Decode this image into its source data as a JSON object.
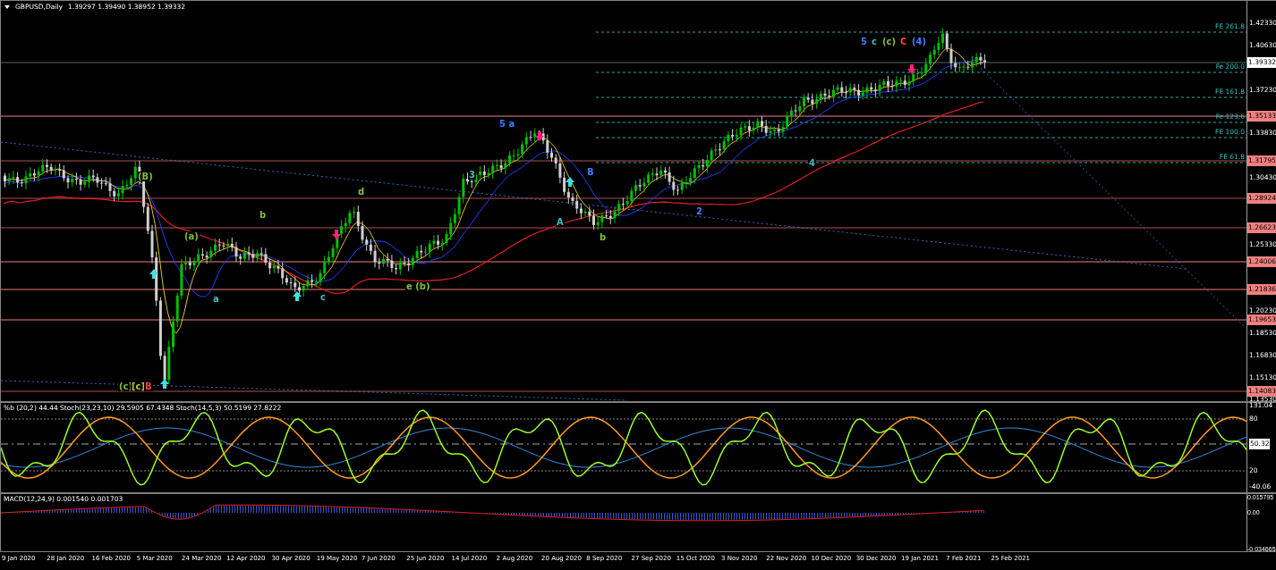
{
  "header": {
    "symbol": "GBPUSD,Daily",
    "quotes": "1.39297 1.39490 1.38952 1.39332"
  },
  "price_axis": [
    "1.42330",
    "1.40630",
    "1.37230",
    "1.33830",
    "1.30430",
    "1.25330",
    "1.20230",
    "1.18530",
    "1.16830",
    "1.15130",
    "1.13530"
  ],
  "current_price": "1.39332",
  "levels": [
    "1.35133",
    "1.31795",
    "1.28924",
    "1.26623",
    "1.24006",
    "1.21836",
    "1.19653",
    "1.14083"
  ],
  "fib_levels": [
    "FE 261.8",
    "Fe 200.0",
    "FE 161.8",
    "Fe 123.6",
    "FE 100.0",
    "FE 61.8"
  ],
  "wave_labels": [
    {
      "text": "(B)",
      "color": "#7fbf3f"
    },
    {
      "text": "(a)",
      "color": "#7fbf3f"
    },
    {
      "text": "b",
      "color": "#7fbf3f"
    },
    {
      "text": "d",
      "color": "#7fbf3f"
    },
    {
      "text": "a",
      "color": "#3fbfbf"
    },
    {
      "text": "c",
      "color": "#3fbfbf"
    },
    {
      "text": "e (b)",
      "color": "#7fbf3f"
    },
    {
      "text": "5 a",
      "color": "#3f7fff"
    },
    {
      "text": "B",
      "color": "#3f7fff"
    },
    {
      "text": "A",
      "color": "#3fbfbf"
    },
    {
      "text": "b",
      "color": "#7fbf3f"
    },
    {
      "text": "3",
      "color": "#3fbfbf"
    },
    {
      "text": "2",
      "color": "#3f7fff"
    },
    {
      "text": "4",
      "color": "#3fbfbf"
    },
    {
      "text": "(c)",
      "color": "#7fbf3f"
    },
    {
      "text": "[c]",
      "color": "#bfbf3f"
    },
    {
      "text": "B",
      "color": "#ff3f3f"
    },
    {
      "text": "5",
      "color": "#3f7fff"
    },
    {
      "text": "c",
      "color": "#3fbfbf"
    },
    {
      "text": "(c)",
      "color": "#7fbf3f"
    },
    {
      "text": "C",
      "color": "#ff3f3f"
    },
    {
      "text": "(4)",
      "color": "#3f7fff"
    }
  ],
  "oscillator": {
    "header": "%b (20,2) 44.44  Stoch(23,23,10) 29.5905 67.4348  Stoch(14,5,3) 50.5199 27.8222",
    "axis": [
      "131.04",
      "80",
      "50.32",
      "20",
      "-40.06"
    ]
  },
  "macd": {
    "header": "MACD(12,24,9) 0.001540 0.001703",
    "axis": [
      "0.015795",
      "0.00",
      "-0.034665"
    ]
  },
  "dates": [
    "9 Jan 2020",
    "28 Jan 2020",
    "16 Feb 2020",
    "5 Mar 2020",
    "24 Mar 2020",
    "12 Apr 2020",
    "30 Apr 2020",
    "19 May 2020",
    "7 Jun 2020",
    "25 Jun 2020",
    "14 Jul 2020",
    "2 Aug 2020",
    "20 Aug 2020",
    "8 Sep 2020",
    "27 Sep 2020",
    "15 Oct 2020",
    "3 Nov 2020",
    "22 Nov 2020",
    "10 Dec 2020",
    "30 Dec 2020",
    "19 Jan 2021",
    "7 Feb 2021",
    "25 Feb 2021"
  ]
}
